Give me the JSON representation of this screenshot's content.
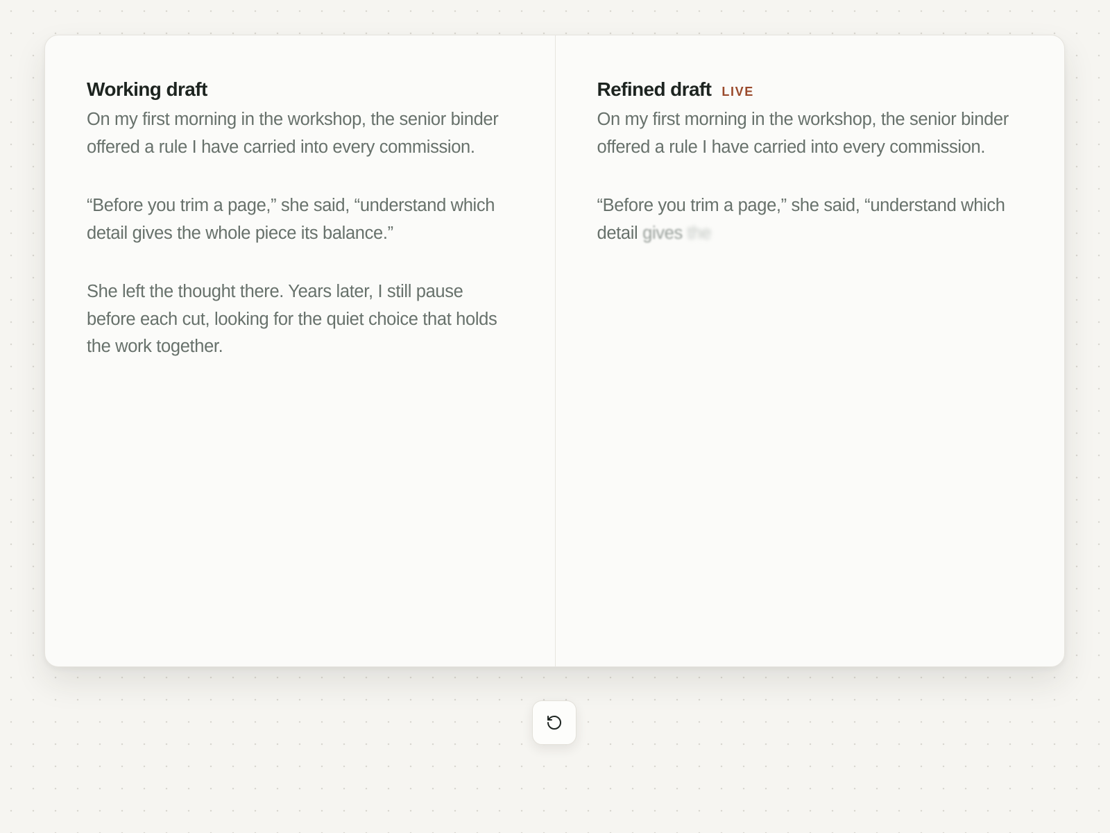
{
  "working_draft": {
    "title": "Working draft",
    "paragraphs": [
      "On my first morning in the workshop, the senior binder offered a rule I have carried into every commission.",
      "“Before you trim a page,” she said, “understand which detail gives the whole piece its balance.”",
      "She left the thought there. Years later, I still pause before each cut, looking for the quiet choice that holds the work together."
    ]
  },
  "refined_draft": {
    "title": "Refined draft",
    "badge": "LIVE",
    "paragraphs": [
      "On my first morning in the workshop, the senior binder offered a rule I have carried into every commission."
    ],
    "streaming_paragraph": {
      "text": "“Before you trim a page,” she said, “understand which detail",
      "fading_words": [
        "gives",
        "the"
      ]
    }
  },
  "controls": {
    "reset_icon": "rotate-ccw-icon"
  },
  "colors": {
    "background": "#f6f5f1",
    "card": "#fbfbf9",
    "heading": "#1d2420",
    "body_text": "#67716b",
    "live_badge": "#9a4a2c"
  }
}
